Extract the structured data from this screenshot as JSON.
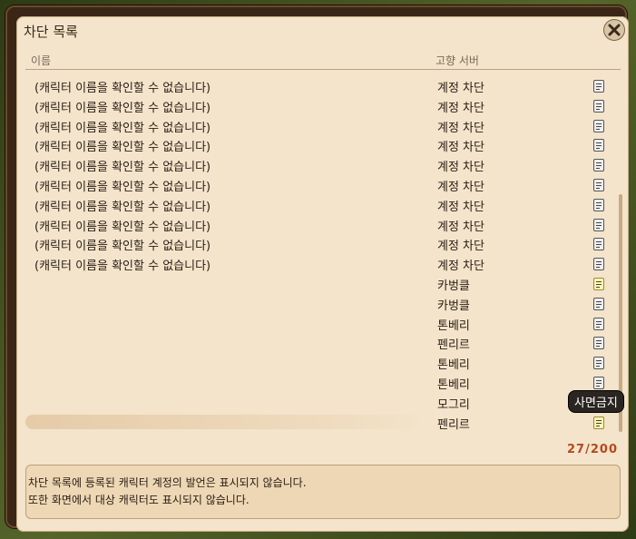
{
  "window": {
    "title": "차단 목록"
  },
  "columns": {
    "name": "이름",
    "server": "고향 서버"
  },
  "rows": [
    {
      "name": "(캐릭터 이름을 확인할 수 없습니다)",
      "server": "계정 차단",
      "memo": "gray"
    },
    {
      "name": "(캐릭터 이름을 확인할 수 없습니다)",
      "server": "계정 차단",
      "memo": "gray"
    },
    {
      "name": "(캐릭터 이름을 확인할 수 없습니다)",
      "server": "계정 차단",
      "memo": "gray"
    },
    {
      "name": "(캐릭터 이름을 확인할 수 없습니다)",
      "server": "계정 차단",
      "memo": "gray"
    },
    {
      "name": "(캐릭터 이름을 확인할 수 없습니다)",
      "server": "계정 차단",
      "memo": "gray"
    },
    {
      "name": "(캐릭터 이름을 확인할 수 없습니다)",
      "server": "계정 차단",
      "memo": "gray"
    },
    {
      "name": "(캐릭터 이름을 확인할 수 없습니다)",
      "server": "계정 차단",
      "memo": "gray"
    },
    {
      "name": "(캐릭터 이름을 확인할 수 없습니다)",
      "server": "계정 차단",
      "memo": "gray"
    },
    {
      "name": "(캐릭터 이름을 확인할 수 없습니다)",
      "server": "계정 차단",
      "memo": "gray"
    },
    {
      "name": "(캐릭터 이름을 확인할 수 없습니다)",
      "server": "계정 차단",
      "memo": "gray"
    },
    {
      "name": "",
      "server": "카벙클",
      "memo": "yellow"
    },
    {
      "name": "",
      "server": "카벙클",
      "memo": "gray"
    },
    {
      "name": "",
      "server": "톤베리",
      "memo": "gray"
    },
    {
      "name": "",
      "server": "펜리르",
      "memo": "gray"
    },
    {
      "name": "",
      "server": "톤베리",
      "memo": "gray"
    },
    {
      "name": "",
      "server": "톤베리",
      "memo": "gray"
    },
    {
      "name": "",
      "server": "모그리",
      "memo": "gray"
    },
    {
      "name": "",
      "server": "펜리르",
      "memo": "yellow",
      "selected": true
    }
  ],
  "tooltip": "사면금지",
  "count": "27/200",
  "notice": {
    "line1": "차단 목록에 등록된 캐릭터 계정의 발언은 표시되지 않습니다.",
    "line2": "또한 화면에서 대상 캐릭터도 표시되지 않습니다."
  },
  "icons": {
    "close": "close-icon",
    "memo": "memo-icon"
  }
}
